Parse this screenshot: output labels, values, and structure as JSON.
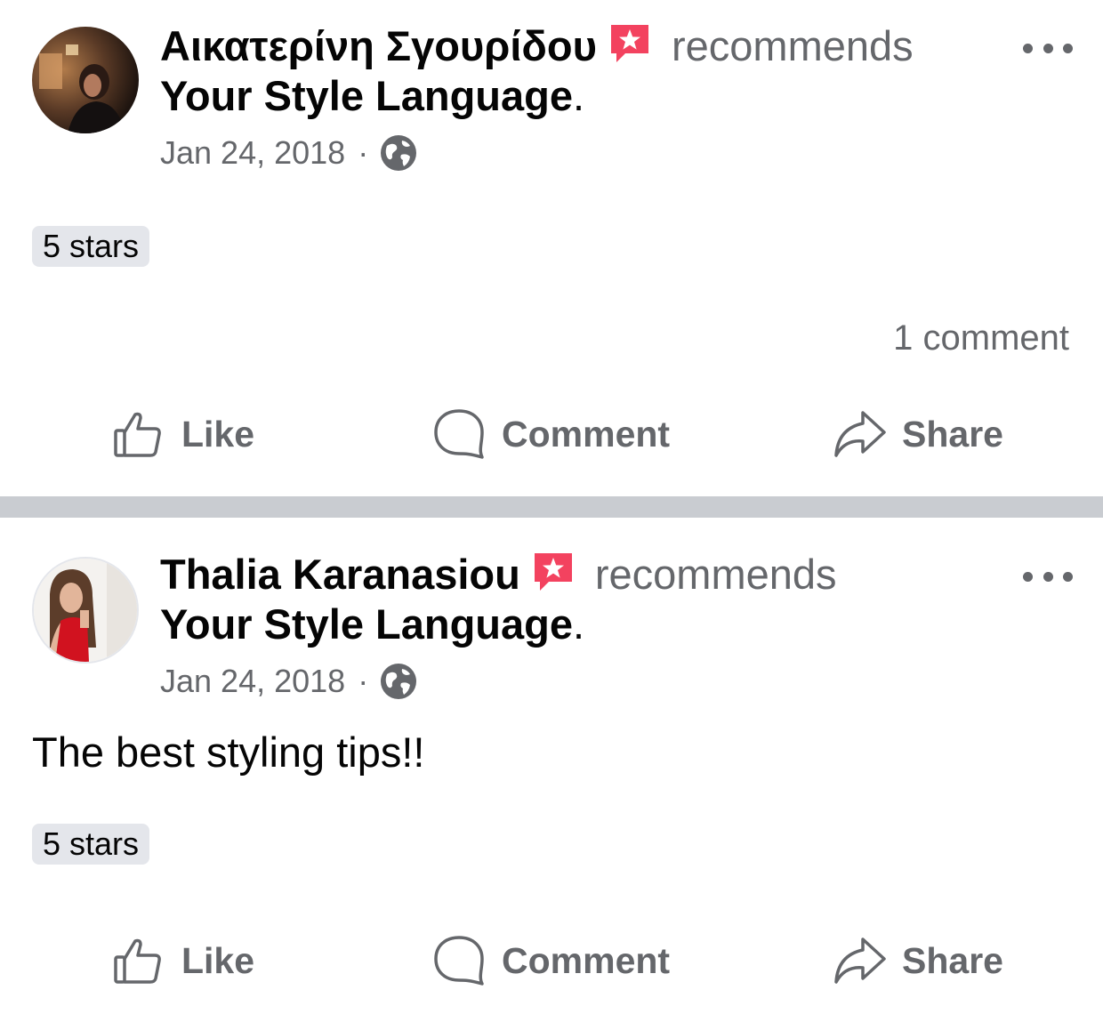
{
  "colors": {
    "text": "#050505",
    "secondary": "#65676b",
    "badge": "#f3425f",
    "separator": "#c9ccd1",
    "pill": "#e4e6eb"
  },
  "posts": [
    {
      "author": "Αικατερίνη Σγουρίδου",
      "verb": "recommends",
      "page": "Your Style Language",
      "page_suffix": ".",
      "date": "Jan 24, 2018",
      "date_sep": "·",
      "privacy_icon": "globe-icon",
      "body": "",
      "rating": "5 stars",
      "comments": "1 comment",
      "actions": {
        "like": "Like",
        "comment": "Comment",
        "share": "Share"
      }
    },
    {
      "author": "Thalia Karanasiou",
      "verb": "recommends",
      "page": "Your Style Language",
      "page_suffix": ".",
      "date": "Jan 24, 2018",
      "date_sep": "·",
      "privacy_icon": "globe-icon",
      "body": "The best styling tips!!",
      "rating": "5 stars",
      "comments": "",
      "actions": {
        "like": "Like",
        "comment": "Comment",
        "share": "Share"
      }
    }
  ]
}
